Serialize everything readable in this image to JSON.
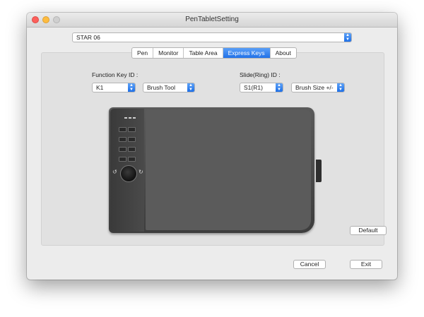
{
  "window": {
    "title": "PenTabletSetting"
  },
  "device": {
    "selected": "STAR 06"
  },
  "tabs": [
    {
      "label": "Pen",
      "active": false
    },
    {
      "label": "Monitor",
      "active": false
    },
    {
      "label": "Table Area",
      "active": false
    },
    {
      "label": "Express Keys",
      "active": true
    },
    {
      "label": "About",
      "active": false
    }
  ],
  "function_key": {
    "label": "Function Key ID :",
    "id_value": "K1",
    "action_value": "Brush Tool"
  },
  "slide_ring": {
    "label": "Slide(Ring) ID :",
    "id_value": "S1(R1)",
    "action_value": "Brush Size +/-"
  },
  "buttons": {
    "default": "Default",
    "cancel": "Cancel",
    "exit": "Exit"
  },
  "icons": {
    "rotate_ccw": "↺",
    "rotate_cw": "↻"
  },
  "colors": {
    "accent": "#2272e8",
    "tablet": "#4a4a4a"
  }
}
